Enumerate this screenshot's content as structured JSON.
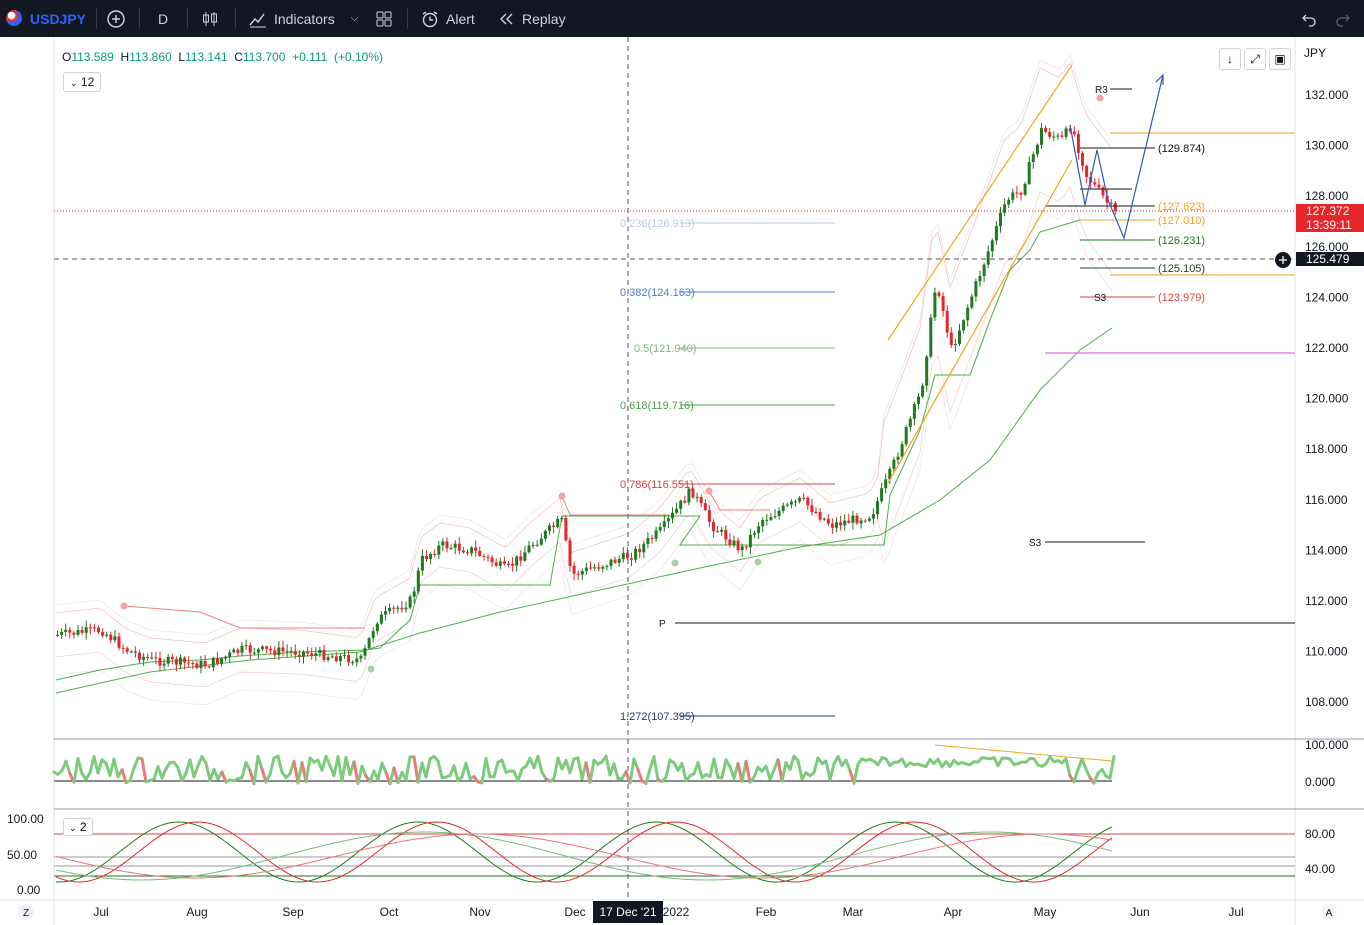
{
  "toolbar": {
    "symbol": "USDJPY",
    "interval": "D",
    "indicators_label": "Indicators",
    "alert_label": "Alert",
    "replay_label": "Replay"
  },
  "legend": {
    "open_key": "O",
    "open": "113.589",
    "high_key": "H",
    "high": "113.860",
    "low_key": "L",
    "low": "113.141",
    "close_key": "C",
    "close": "113.700",
    "change": "+0.111",
    "change_pct": "(+0.10%)",
    "interval_badge": "12",
    "osc_badge": "2"
  },
  "price_axis": {
    "currency": "JPY",
    "ticks": [
      "132.000",
      "130.000",
      "128.000",
      "126.000",
      "124.000",
      "122.000",
      "120.000",
      "118.000",
      "116.000",
      "114.000",
      "112.000",
      "110.000",
      "108.000"
    ],
    "last_price": "127.372",
    "countdown": "13:39:11",
    "crosshair_price": "125.479"
  },
  "osc1_axis": {
    "ticks": [
      "100.000",
      "0.000"
    ]
  },
  "osc2_axis": {
    "left_ticks": [
      "100.00",
      "50.00",
      "0.00"
    ],
    "right_ticks": [
      "80.00",
      "40.00"
    ]
  },
  "time_axis": {
    "labels": [
      "Jul",
      "Aug",
      "Sep",
      "Oct",
      "Nov",
      "Dec",
      "2022",
      "Feb",
      "Mar",
      "Apr",
      "May",
      "Jun",
      "Jul"
    ],
    "crosshair_date": "17 Dec '21",
    "left_btn": "Z",
    "right_btn": "A"
  },
  "fib_labels": {
    "f236": "0.236(126.913)",
    "f382": "0.382(124.163)",
    "f5": "0.5(121.940)",
    "f618": "0.618(119.716)",
    "f786": "0.786(116.551)",
    "f1272": "1.272(107.395)"
  },
  "pivot_labels": {
    "r3": "R3",
    "s3_upper": "S3",
    "s3_lower": "S3",
    "p": "P",
    "l129": "(129.874)",
    "l127_6": "(127.623)",
    "l127_0": "(127.010)",
    "l126": "(126.231)",
    "l125": "(125.105)",
    "l123": "(123.979)"
  },
  "colors": {
    "up": "#1e7a1e",
    "down": "#e5262b",
    "accent": "#2962ff",
    "orange": "#f7a21b"
  }
}
